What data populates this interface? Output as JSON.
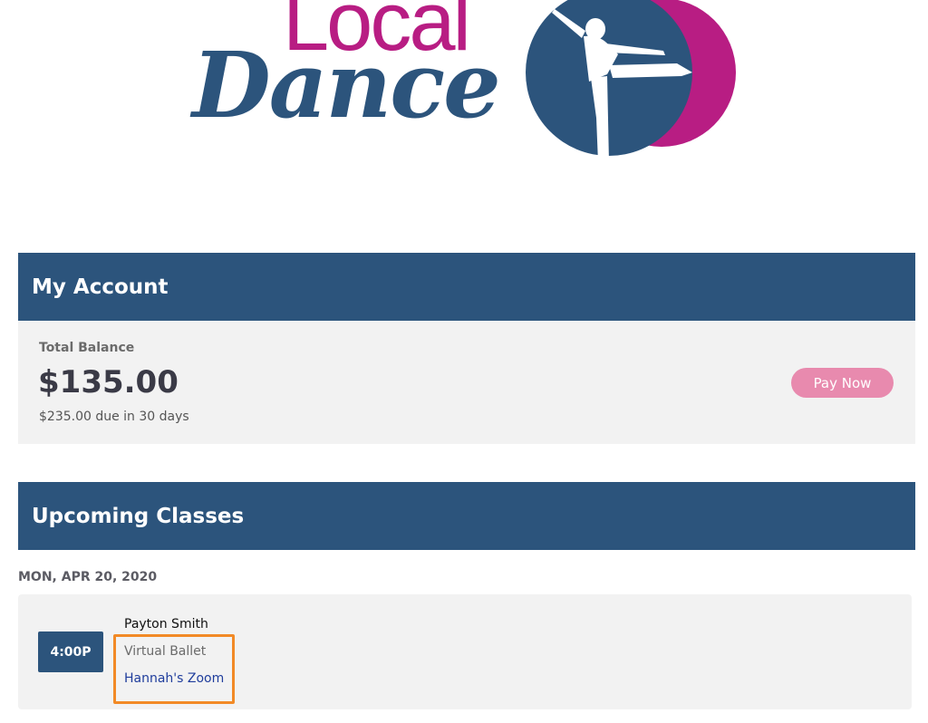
{
  "brand": {
    "logo_local": "Local",
    "logo_dance": "Dance",
    "colors": {
      "navy": "#2c547c",
      "magenta": "#b81d83"
    }
  },
  "account": {
    "header": "My Account",
    "balance_label": "Total Balance",
    "balance_amount": "$135.00",
    "due_text": "$235.00 due in 30 days",
    "pay_button_label": "Pay Now"
  },
  "classes": {
    "header": "Upcoming Classes",
    "date": "MON, APR 20, 2020",
    "items": [
      {
        "time": "4:00P",
        "student": "Payton Smith",
        "class_name": "Virtual Ballet",
        "link_label": "Hannah's Zoom"
      }
    ]
  }
}
